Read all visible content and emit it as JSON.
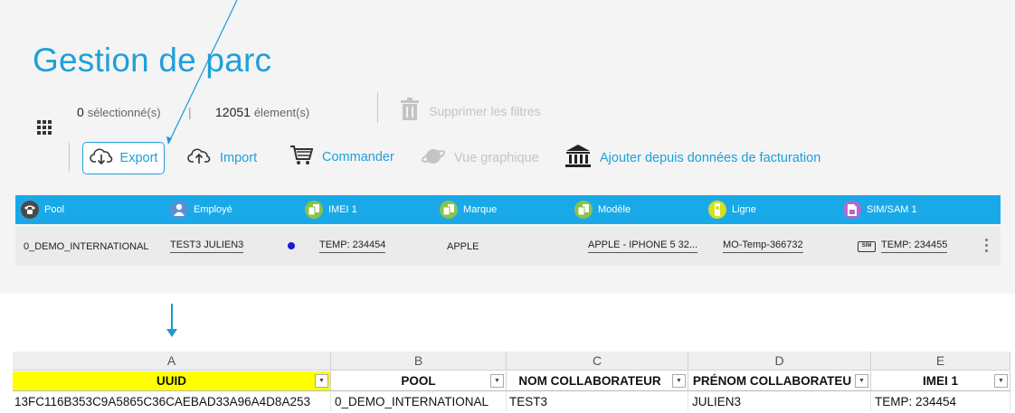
{
  "page": {
    "title": "Gestion de parc"
  },
  "selection": {
    "selected_count": "0",
    "selected_label": "sélectionné(s)",
    "separator": "|",
    "total_count": "12051",
    "total_label": "élement(s)"
  },
  "toolbar": {
    "clear_filters": "Supprimer les filtres",
    "export": "Export",
    "import": "Import",
    "order": "Commander",
    "graph_view": "Vue graphique",
    "add_from_billing": "Ajouter depuis données de facturation"
  },
  "table": {
    "columns": [
      {
        "label": "Pool",
        "icon": "phone-icon",
        "color": "#4a4a4a"
      },
      {
        "label": "Employé",
        "icon": "user-icon",
        "color": "#5b8fd0"
      },
      {
        "label": "IMEI 1",
        "icon": "device-icon",
        "color": "#8bc34a"
      },
      {
        "label": "Marque",
        "icon": "device-icon",
        "color": "#8bc34a"
      },
      {
        "label": "Modèle",
        "icon": "device-icon",
        "color": "#8bc34a"
      },
      {
        "label": "Ligne",
        "icon": "line-icon",
        "color": "#d4e021"
      },
      {
        "label": "SIM/SAM 1",
        "icon": "sim-icon",
        "color": "#b06ad0"
      }
    ],
    "row": {
      "pool": "0_DEMO_INTERNATIONAL",
      "employee": "TEST3 JULIEN3",
      "imei": "TEMP: 234454",
      "brand": "APPLE",
      "model": "APPLE - IPHONE 5 32...",
      "line": "MO-Temp-366732",
      "sim_badge": "SIM",
      "sim": "TEMP: 234455"
    }
  },
  "sheet": {
    "columns": [
      "A",
      "B",
      "C",
      "D",
      "E"
    ],
    "headers": [
      "UUID",
      "POOL",
      "NOM COLLABORATEUR",
      "PRÉNOM COLLABORATEU",
      "IMEI 1"
    ],
    "row": [
      "13FC116B353C9A5865C36CAEBAD33A96A4D8A253",
      "0_DEMO_INTERNATIONAL",
      "TEST3",
      "JULIEN3",
      "TEMP: 234454"
    ],
    "highlight_color": "#ffff00"
  },
  "colors": {
    "accent": "#1ea0da",
    "header_bar": "#1aa9e8",
    "disabled": "#c4c4c4"
  }
}
